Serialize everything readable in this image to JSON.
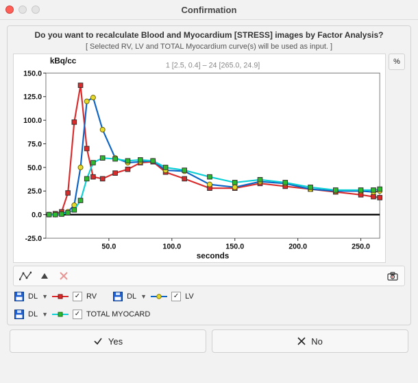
{
  "window": {
    "title": "Confirmation"
  },
  "dialog": {
    "question": "Do you want to recalculate Blood and Myocardium [STRESS] images by Factor Analysis?",
    "subquestion": "[ Selected RV, LV and TOTAL Myocardium curve(s) will be used as input. ]"
  },
  "chart": {
    "ylabel": "kBq/cc",
    "xlabel": "seconds",
    "range_label": "1 [2.5, 0.4] – 24 [265.0, 24.9]",
    "pct_button": "%"
  },
  "chart_data": {
    "type": "line",
    "xlabel": "seconds",
    "ylabel": "kBq/cc",
    "xlim": [
      0,
      265
    ],
    "ylim": [
      -25,
      150
    ],
    "xticks": [
      50,
      100,
      150,
      200,
      250
    ],
    "yticks": [
      -25,
      0,
      25,
      50,
      75,
      100,
      125,
      150
    ],
    "x": [
      2.5,
      7.5,
      12.5,
      17.5,
      22.5,
      27.5,
      32.5,
      37.5,
      45,
      55,
      65,
      75,
      85,
      95,
      110,
      130,
      150,
      170,
      190,
      210,
      230,
      250,
      260,
      265
    ],
    "series": [
      {
        "name": "RV",
        "marker": "square",
        "color": "#d92b2b",
        "line": "#d92b2b",
        "values": [
          0,
          1,
          3,
          23,
          98,
          137,
          70,
          40,
          38,
          44,
          48,
          55,
          56,
          45,
          38,
          28,
          28,
          33,
          30,
          27,
          24,
          21,
          19,
          18
        ]
      },
      {
        "name": "LV",
        "marker": "circle",
        "color": "#e6d92e",
        "line": "#0b63c5",
        "values": [
          0,
          0,
          1,
          3,
          10,
          50,
          120,
          124,
          90,
          60,
          55,
          56,
          57,
          47,
          46,
          32,
          29,
          35,
          33,
          27,
          25,
          25,
          24,
          25
        ]
      },
      {
        "name": "TOTAL MYOCARD",
        "marker": "square",
        "color": "#2fb92f",
        "line": "#0ccfd6",
        "values": [
          0,
          0,
          0.5,
          2,
          5,
          15,
          38,
          55,
          60,
          59,
          57,
          58,
          57,
          50,
          47,
          40,
          34,
          37,
          34,
          29,
          26,
          26,
          26,
          27
        ]
      }
    ]
  },
  "legend": {
    "dl_label": "DL",
    "items": [
      {
        "key": "RV",
        "label": "RV",
        "checked": true
      },
      {
        "key": "LV",
        "label": "LV",
        "checked": true
      },
      {
        "key": "TOTAL MYOCARD",
        "label": "TOTAL MYOCARD",
        "checked": true
      }
    ]
  },
  "buttons": {
    "yes": "Yes",
    "no": "No"
  }
}
